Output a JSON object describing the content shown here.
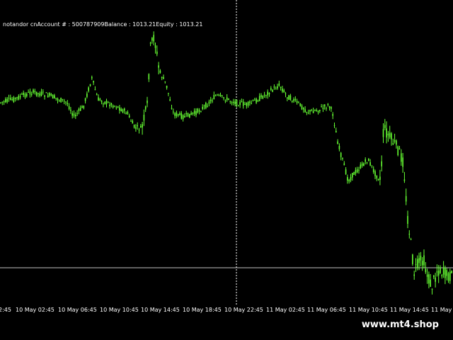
{
  "account_info": "notandor cnAccount # : 500787909Balance : 1013.21Equity : 1013.21",
  "x_labels": [
    "10 May 02:45",
    "10 May 06:45",
    "10 May 10:45",
    "10 May 14:45",
    "10 May 18:45",
    "10 May 22:45",
    "11 May 02:45",
    "11 May 06:45",
    "11 May 10:45",
    "11 May 14:45",
    "11 May"
  ],
  "x_label_left_fragment": "2:45",
  "watermark": "www.mt4.shop",
  "colors": {
    "candle": "#66ff33",
    "background": "#000000",
    "text": "#ffffff",
    "level_line": "#c0c0c0"
  }
}
